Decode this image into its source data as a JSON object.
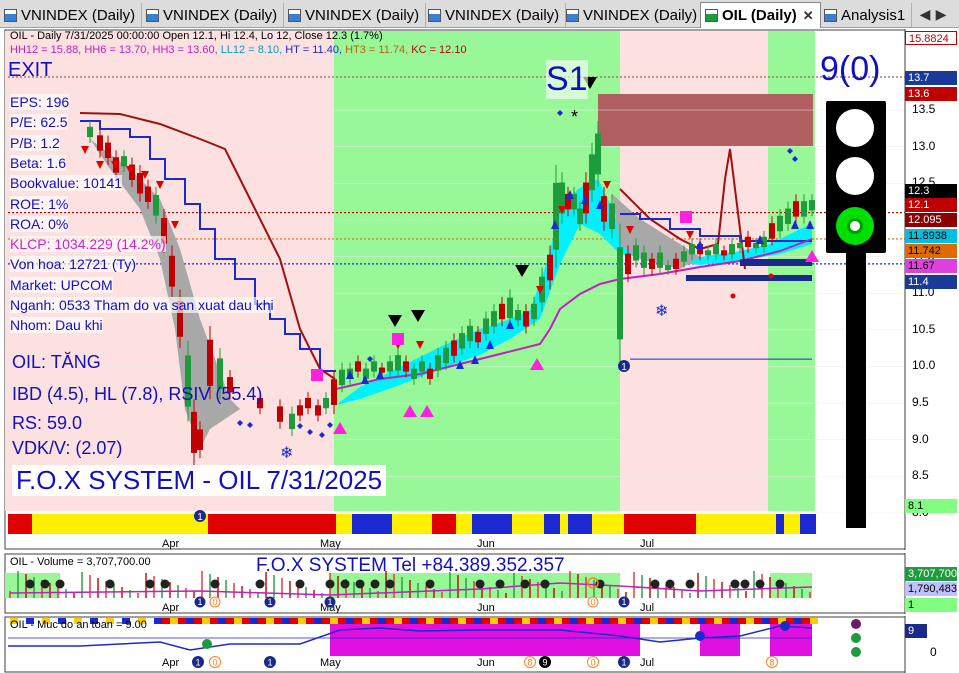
{
  "tabs": [
    {
      "label": "VNINDEX (Daily)",
      "active": false
    },
    {
      "label": "VNINDEX (Daily)",
      "active": false
    },
    {
      "label": "VNINDEX (Daily)",
      "active": false
    },
    {
      "label": "VNINDEX (Daily)",
      "active": false
    },
    {
      "label": "VNINDEX (Daily)",
      "active": false
    },
    {
      "label": "OIL (Daily)",
      "active": true,
      "close": "✕"
    },
    {
      "label": "Analysis1",
      "active": false
    }
  ],
  "main_panel": {
    "header_line1": "OIL - Daily 7/31/2025 00:00:00 Open 12.1, Hi 12.4, Lo 12, Close 12.3 (1.7%)",
    "header_line2": {
      "hh12": "HH12 = 15.88,",
      "hh6": "HH6 = 13.70,",
      "hh3": "HH3 = 13.60,",
      "ll12": "LL12 = 8.10,",
      "ht": "HT = 11.40,",
      "ht3": "HT3 = 11.74,",
      "kc": "KC = 12.10"
    },
    "exit_label": "EXIT",
    "s1_label": "S1",
    "signal_count": "9(0)",
    "fundamentals": [
      {
        "text": "EPS: 196",
        "color": "#1010c0"
      },
      {
        "text": "P/E: 62.5",
        "color": "#1010c0"
      },
      {
        "text": "P/B: 1.2",
        "color": "#1010c0"
      },
      {
        "text": "Beta: 1.6",
        "color": "#1010c0"
      },
      {
        "text": "Bookvalue: 10141",
        "color": "#1010c0"
      },
      {
        "text": "ROE: 1%",
        "color": "#1010c0"
      },
      {
        "text": "ROA: 0%",
        "color": "#1010c0"
      },
      {
        "text": "KLCP: 1034.229 (14.2%)",
        "color": "#d020d0"
      },
      {
        "text": "Von hoa: 12721 (Ty)",
        "color": "#1010c0"
      },
      {
        "text": "Market: UPCOM",
        "color": "#1010c0"
      },
      {
        "text": "Nganh: 0533 Tham do va san xuat dau khi",
        "color": "#1010c0"
      },
      {
        "text": "Nhom: Dau khi",
        "color": "#1010c0"
      }
    ],
    "trend_text": "OIL: TĂNG",
    "ibd_text": "IBD (4.5), HL (7.8), RSIV (55.4)",
    "rs_text": "RS: 59.0",
    "vdk_text": "VDK/V:  (2.07)",
    "fox_title": "F.O.X SYSTEM - OIL 7/31/2025",
    "y_axis_ticks": [
      "13.5",
      "13.0",
      "12.5",
      "12.0",
      "11.5",
      "11.0",
      "10.5",
      "10.0",
      "9.5",
      "9.0",
      "8.5",
      "8.0"
    ],
    "price_tags": [
      {
        "text": "15.8824",
        "bg": "#ffffff",
        "fg": "#c00000"
      },
      {
        "text": "13.7",
        "bg": "#1a3a9a",
        "fg": "#ffffff"
      },
      {
        "text": "13.6",
        "bg": "#c00000",
        "fg": "#ffffff"
      },
      {
        "text": "12.3",
        "bg": "#000000",
        "fg": "#ffffff"
      },
      {
        "text": "12.1",
        "bg": "#c00000",
        "fg": "#ffffff"
      },
      {
        "text": "12.095",
        "bg": "#8b0000",
        "fg": "#ffffff"
      },
      {
        "text": "11.8938",
        "bg": "#00c0e0",
        "fg": "#000000"
      },
      {
        "text": "11.742",
        "bg": "#e06a00",
        "fg": "#000000"
      },
      {
        "text": "11.67",
        "bg": "#e040e0",
        "fg": "#000000"
      },
      {
        "text": "11.4",
        "bg": "#1a3a9a",
        "fg": "#ffffff"
      },
      {
        "text": "8.1",
        "bg": "#80ff80",
        "fg": "#000000"
      }
    ],
    "months": [
      "Apr",
      "May",
      "Jun",
      "Jul"
    ],
    "marker_labels": [
      "1",
      "1"
    ]
  },
  "volume_panel": {
    "title_prefix": "OIL - Volume = ",
    "title_value": "3,707,700.00",
    "phone_text": "F.O.X SYSTEM Tel +84.389.352.357",
    "right_tags": [
      "3,707,700",
      "1,790,483",
      "1"
    ],
    "months": [
      "Apr",
      "May",
      "Jun",
      "Jul"
    ],
    "markers": [
      "1",
      "0",
      "1",
      "1",
      "0",
      "1"
    ]
  },
  "safety_panel": {
    "title": "OIL - Muc do an toan = 9.00",
    "right_tags": [
      "9",
      "0"
    ],
    "months": [
      "Apr",
      "May",
      "Jun",
      "Jul"
    ],
    "markers": [
      "1",
      "0",
      "1",
      "8",
      "9",
      "0",
      "1",
      "8"
    ]
  },
  "colors": {
    "bull_zone": "#98f898",
    "bear_zone": "#fde0e0",
    "candle_up": "#1e9b3c",
    "candle_down": "#c00000",
    "blue_line": "#1a2ad0",
    "dark_red_line": "#a01010",
    "magenta_line": "#c020c0",
    "cyan_band": "#00f0ff"
  },
  "icons": [
    "vnindex-tab-icon",
    "oil-tab-icon",
    "analysis-tab-icon",
    "traffic-light-icon"
  ]
}
